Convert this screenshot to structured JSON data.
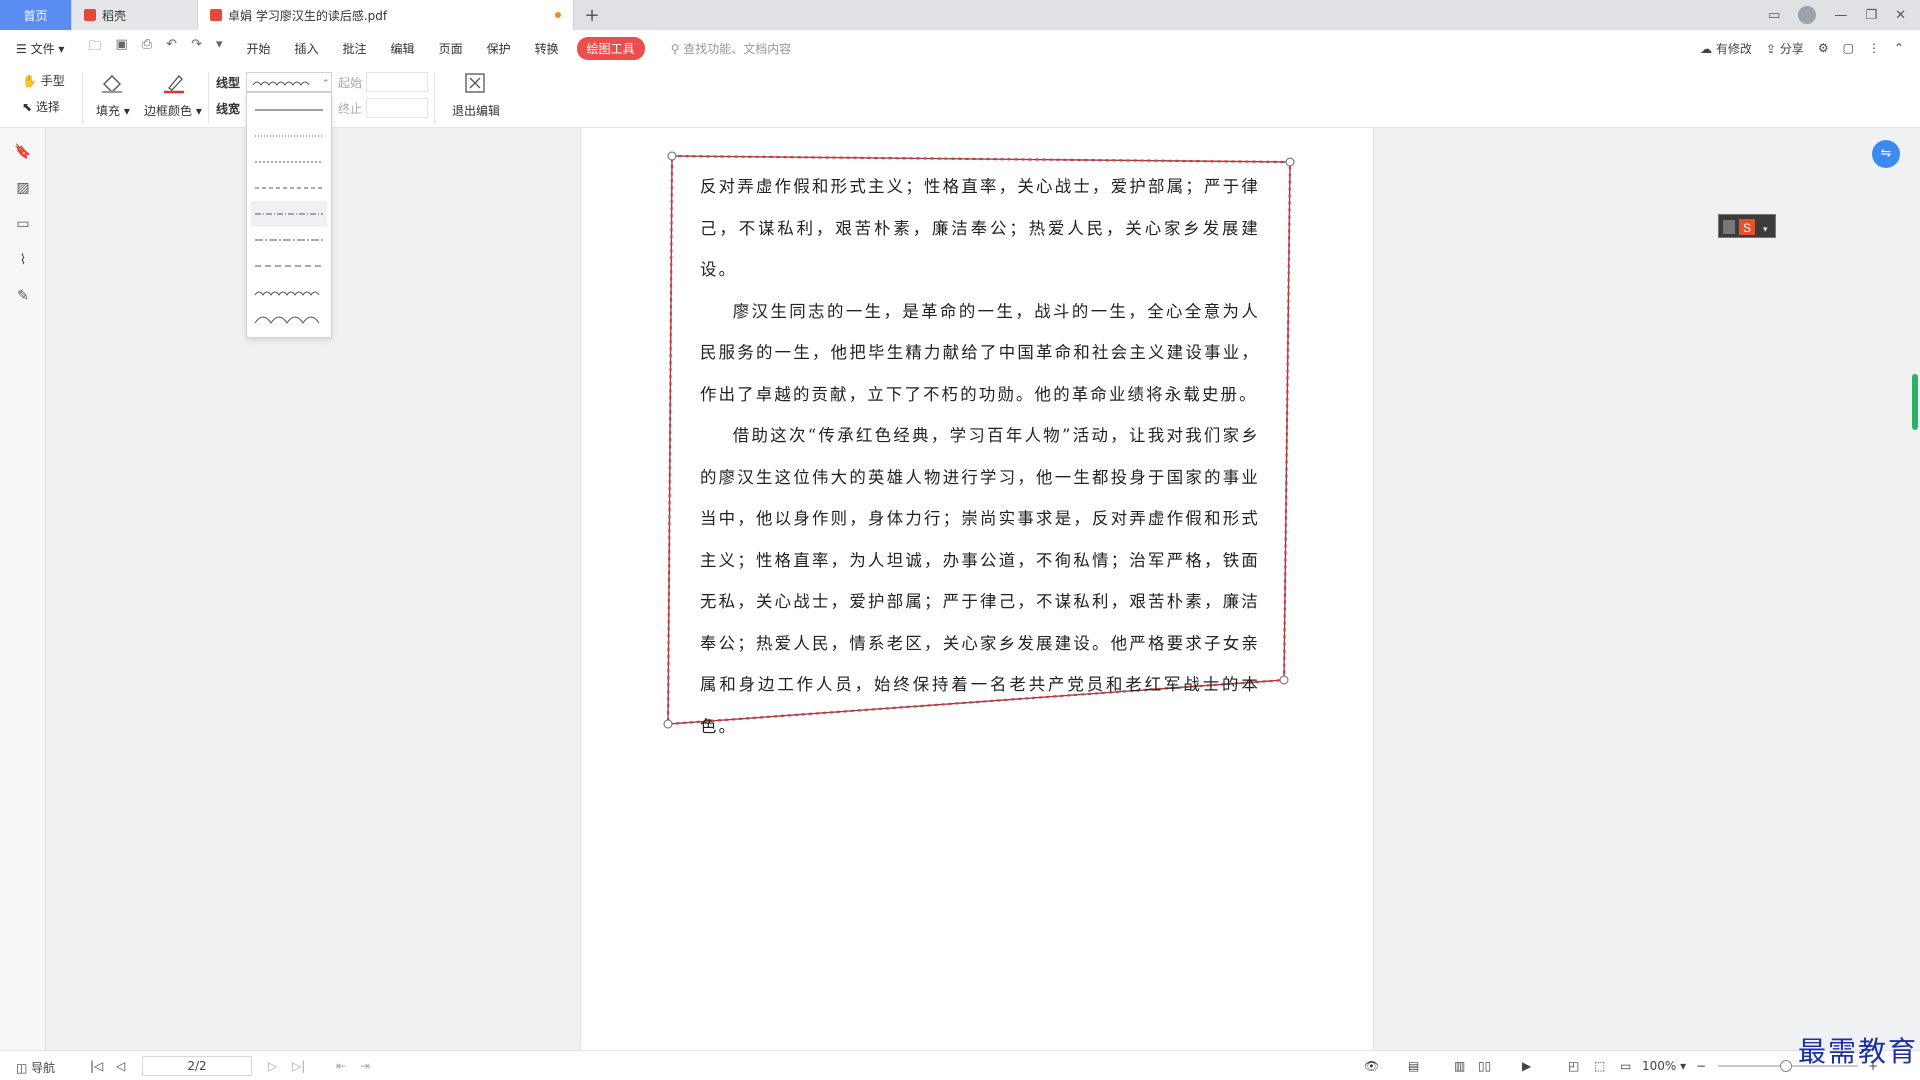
{
  "tabs": {
    "home": "首页",
    "wps": "稻壳",
    "doc": "卓娟 学习廖汉生的读后感.pdf",
    "new_tab": "+"
  },
  "menu": {
    "file": "文件",
    "items": [
      "开始",
      "插入",
      "批注",
      "编辑",
      "页面",
      "保护",
      "转换",
      "绘图工具"
    ],
    "active": "绘图工具",
    "search_placeholder": "查找功能、文档内容",
    "modified": "有修改",
    "share": "分享"
  },
  "tools": {
    "hand": "手型",
    "select": "选择",
    "fill": "填充",
    "border_color": "边框颜色",
    "line_type": "线型",
    "line_width": "线宽",
    "start": "起始",
    "end": "终止",
    "exit_edit": "退出编辑"
  },
  "content": {
    "paragraphs": [
      {
        "indent": false,
        "text": "反对弄虚作假和形式主义；性格直率，关心战士，爱护部属；严于律己，不谋私利，艰苦朴素，廉洁奉公；热爱人民，关心家乡发展建设。"
      },
      {
        "indent": true,
        "text": "廖汉生同志的一生，是革命的一生，战斗的一生，全心全意为人民服务的一生，他把毕生精力献给了中国革命和社会主义建设事业，作出了卓越的贡献，立下了不朽的功勋。他的革命业绩将永载史册。"
      },
      {
        "indent": true,
        "text": "借助这次“传承红色经典，学习百年人物”活动，让我对我们家乡的廖汉生这位伟大的英雄人物进行学习，他一生都投身于国家的事业当中，他以身作则，身体力行；崇尚实事求是，反对弄虚作假和形式主义；性格直率，为人坦诚，办事公道，不徇私情；治军严格，铁面无私，关心战士，爱护部属；严于律己，不谋私利，艰苦朴素，廉洁奉公；热爱人民，情系老区，关心家乡发展建设。他严格要求子女亲属和身边工作人员，始终保持着一名老共产党员和老红军战士的本色。"
      }
    ]
  },
  "shape": {
    "stroke_color": "#e8303a",
    "border_color": "#555555"
  },
  "status": {
    "nav": "导航",
    "page": "2/2",
    "zoom": "100%"
  },
  "watermark": "最需教育",
  "icons": [
    "menu-icon",
    "folder-icon",
    "save-icon",
    "print-icon",
    "undo-icon",
    "redo-icon",
    "search-icon",
    "cloud-icon",
    "share-icon",
    "settings-icon",
    "bookmark-icon",
    "thumbnail-icon",
    "comment-icon",
    "attachment-icon",
    "sign-icon",
    "hand-icon",
    "cursor-icon",
    "fill-icon",
    "pen-icon",
    "exit-icon"
  ]
}
